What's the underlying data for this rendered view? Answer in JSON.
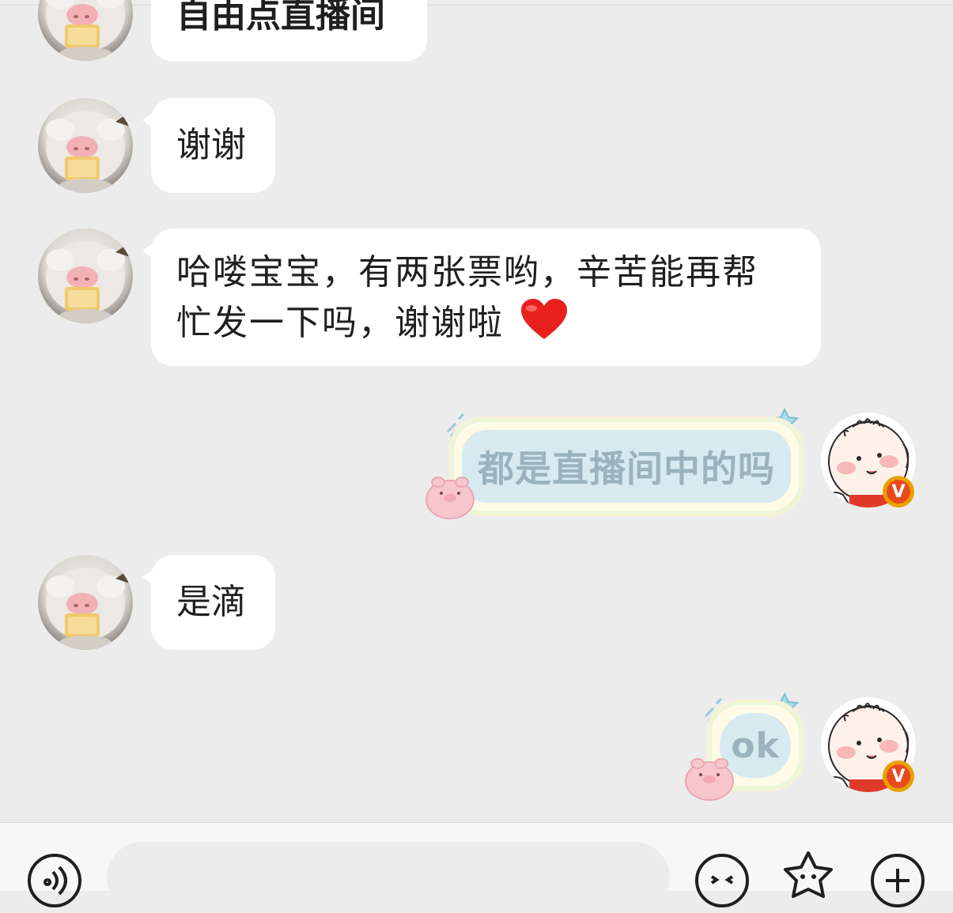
{
  "messages": [
    {
      "id": "m0",
      "direction": "incoming",
      "text": "自由点直播间",
      "sender_avatar": "fluffy-pig-avatar-icon"
    },
    {
      "id": "m1",
      "direction": "incoming",
      "text": "谢谢",
      "sender_avatar": "fluffy-pig-avatar-icon"
    },
    {
      "id": "m2",
      "direction": "incoming",
      "lines": [
        "哈喽宝宝，有两张票哟，辛苦能再帮",
        "忙发一下吗，谢谢啦"
      ],
      "emoji": "red-heart-icon",
      "sender_avatar": "fluffy-pig-avatar-icon"
    },
    {
      "id": "m3",
      "direction": "outgoing",
      "text": "都是直播间中的吗",
      "sender_avatar": "cartoon-baby-avatar-icon",
      "badge": "V"
    },
    {
      "id": "m4",
      "direction": "incoming",
      "text": "是滴",
      "sender_avatar": "fluffy-pig-avatar-icon"
    },
    {
      "id": "m5",
      "direction": "outgoing",
      "text": "ok",
      "sender_avatar": "cartoon-baby-avatar-icon",
      "badge": "V"
    }
  ],
  "input_bar": {
    "voice_icon": "voice-icon",
    "input_value": "",
    "emoji_icon": "emoji-icon",
    "sticker_icon": "sticker-icon",
    "plus_icon": "plus-icon"
  },
  "colors": {
    "background": "#ececec",
    "incoming_bubble": "#ffffff",
    "outgoing_bubble_fill": "#d6eaf0",
    "outgoing_text": "#9bb3bd",
    "badge": "#e8a100"
  }
}
